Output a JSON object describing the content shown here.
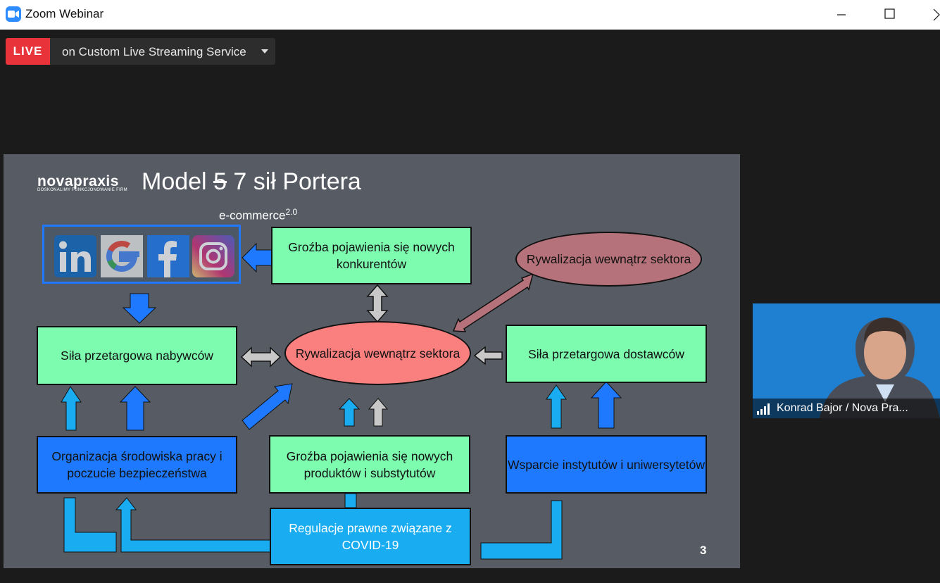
{
  "window": {
    "title": "Zoom Webinar"
  },
  "live": {
    "badge": "LIVE",
    "service": "on Custom Live Streaming Service"
  },
  "slide": {
    "logo_name": "novapraxis",
    "logo_tagline": "DOSKONALIMY FUNKCJONOWANIE FIRM",
    "title_prefix": "Model ",
    "title_struck": "5",
    "title_suffix": " 7 sił Portera",
    "ecommerce_label": "e-commerce",
    "ecommerce_sup": "2.0",
    "social_icons": [
      "linkedin-icon",
      "google-icon",
      "facebook-icon",
      "instagram-icon"
    ],
    "boxes": {
      "new_competitors": "Groźba pojawienia się nowych konkurentów",
      "rivalry_top": "Rywalizacja wewnątrz sektora",
      "buyers": "Siła przetargowa nabywców",
      "rivalry_center": "Rywalizacja wewnątrz sektora",
      "suppliers": "Siła przetargowa dostawców",
      "workplace": "Organizacja środowiska  pracy i poczucie bezpieczeństwa",
      "substitutes": "Groźba pojawienia się nowych produktów i substytutów",
      "institutes": "Wsparcie instytutów i uniwersytetów",
      "covid": "Regulacje prawne związane z COVID-19"
    },
    "page_number": "3"
  },
  "participant": {
    "name": "Konrad Bajor / Nova Pra..."
  },
  "colors": {
    "live_red": "#e8333a",
    "slide_bg": "#575c64",
    "green_box": "#7dfcb0",
    "blue_box": "#1f79ff",
    "cyan_box": "#19acf0",
    "ellipse_red": "#fa7f7f",
    "ellipse_muted": "#b5727a",
    "video_bg": "#1f7fd0"
  }
}
